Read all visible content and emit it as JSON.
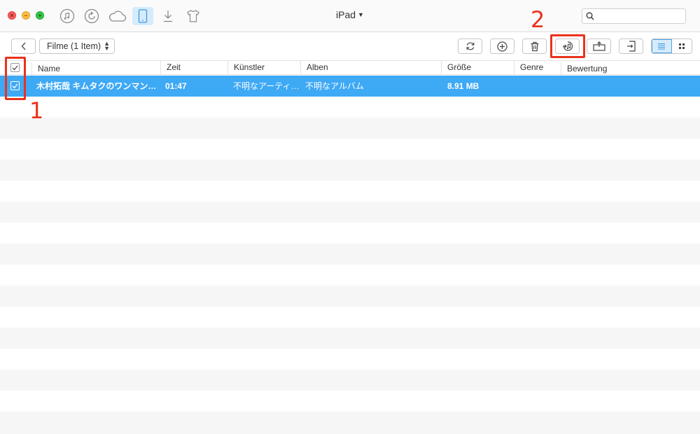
{
  "window": {
    "title": "iPad",
    "search_placeholder": ""
  },
  "top_icons": [
    "music-icon",
    "history-icon",
    "cloud-icon",
    "ipad-icon",
    "download-icon",
    "shirt-icon"
  ],
  "toolbar": {
    "filter_label": "Filme (1 Item)",
    "buttons": [
      "refresh-icon",
      "add-icon",
      "delete-icon",
      "to-itunes-icon",
      "to-device-icon",
      "export-icon"
    ]
  },
  "table": {
    "columns": [
      "Name",
      "Zeit",
      "Künstler",
      "Alben",
      "Größe",
      "Genre",
      "Bewertung"
    ],
    "rows": [
      {
        "name": "木村拓哉 キムタクのワンマン…",
        "zeit": "01:47",
        "kuenstler": "不明なアーティ…",
        "alben": "不明なアルバム",
        "groesse": "8.91 MB",
        "genre": "",
        "bewertung": "",
        "checked": true
      }
    ]
  },
  "annotations": {
    "step1": "1",
    "step2": "2"
  },
  "colors": {
    "selection": "#3ea9f5",
    "highlight": "#e8331c",
    "active_tab": "#d6ebfb"
  }
}
